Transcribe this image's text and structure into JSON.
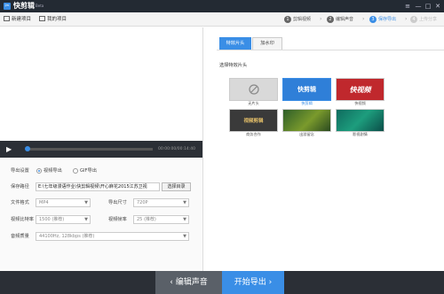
{
  "app": {
    "name": "快剪辑",
    "badge": "Beta"
  },
  "window_controls": {
    "menu": "≡",
    "minimize": "—",
    "maximize": "□",
    "close": "✕"
  },
  "toolbar": {
    "new_project": "新建项目",
    "my_projects": "我的项目"
  },
  "steps": [
    {
      "num": "1",
      "label": "剪辑视频"
    },
    {
      "num": "2",
      "label": "编辑声音"
    },
    {
      "num": "3",
      "label": "保存导出"
    },
    {
      "num": "4",
      "label": "上传分享"
    }
  ],
  "player": {
    "timecode": "00:00:00/00:14:40",
    "progress": 0.0
  },
  "settings": {
    "export_settings_label": "导出设置",
    "export_video": "视频导出",
    "export_gif": "GIF导出",
    "save_path_label": "保存路径",
    "save_path_value": "E:\\七年级漫语作业\\快剪辑视频\\开心麻花2015江苏卫视",
    "choose_dir": "选择目录",
    "file_format_label": "文件格式",
    "file_format_value": "MP4",
    "export_size_label": "导出尺寸",
    "export_size_value": "720P",
    "video_bitrate_label": "视频比特率",
    "video_bitrate_value": "1500 (推荐)",
    "video_fps_label": "视频帧率",
    "video_fps_value": "25 (推荐)",
    "audio_quality_label": "音频质量",
    "audio_quality_value": "44100Hz, 128kbps (推荐)"
  },
  "bottom": {
    "edit_audio": "编辑声音",
    "start_export": "开始导出"
  },
  "right": {
    "tabs": [
      {
        "label": "特效片头"
      },
      {
        "label": "加水印"
      }
    ],
    "section_label": "选择特效片头",
    "thumbnails": [
      {
        "title": "",
        "caption": "无片头",
        "style": "none"
      },
      {
        "title": "快剪辑",
        "caption": "快剪辑",
        "style": "kjj"
      },
      {
        "title": "快视频",
        "caption": "快视频",
        "style": "ksp"
      },
      {
        "title": "视频剪辑",
        "caption": "商务合作",
        "style": "biz"
      },
      {
        "title": "",
        "caption": "出游留念",
        "style": "trip"
      },
      {
        "title": "",
        "caption": "影视剧情",
        "style": "film"
      }
    ]
  },
  "colors": {
    "accent": "#3a8ee6",
    "titlebar": "#232a33",
    "bottombar": "#2b2f36"
  }
}
